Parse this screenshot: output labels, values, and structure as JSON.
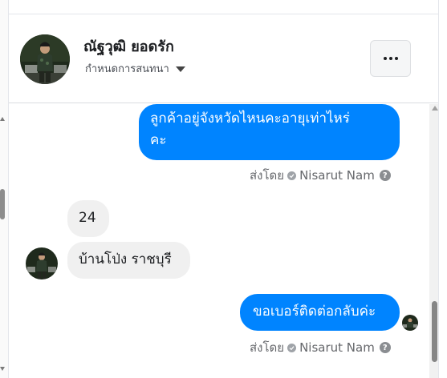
{
  "header": {
    "name": "ณัฐวุฒิ ยอดรัก",
    "subtitle": "กำหนดการสนทนา",
    "more_icon": "more-horizontal-icon"
  },
  "messages": [
    {
      "direction": "outgoing",
      "text_line1": "ลูกค้าอยู่จังหวัดไหนคะอายุเท่าไหร่",
      "text_line2": "คะ"
    },
    {
      "direction": "incoming",
      "text": "24"
    },
    {
      "direction": "incoming",
      "text": "บ้านโป่ง ราชบุรี"
    },
    {
      "direction": "outgoing",
      "text": "ขอเบอร์ติดต่อกลับค่ะ"
    }
  ],
  "sent_by": {
    "label": "ส่งโดย",
    "sender": "Nisarut Nam",
    "help": "?"
  },
  "colors": {
    "outgoing_bubble": "#0084ff",
    "incoming_bubble": "#f0f0f0",
    "meta_text": "#65676b"
  }
}
